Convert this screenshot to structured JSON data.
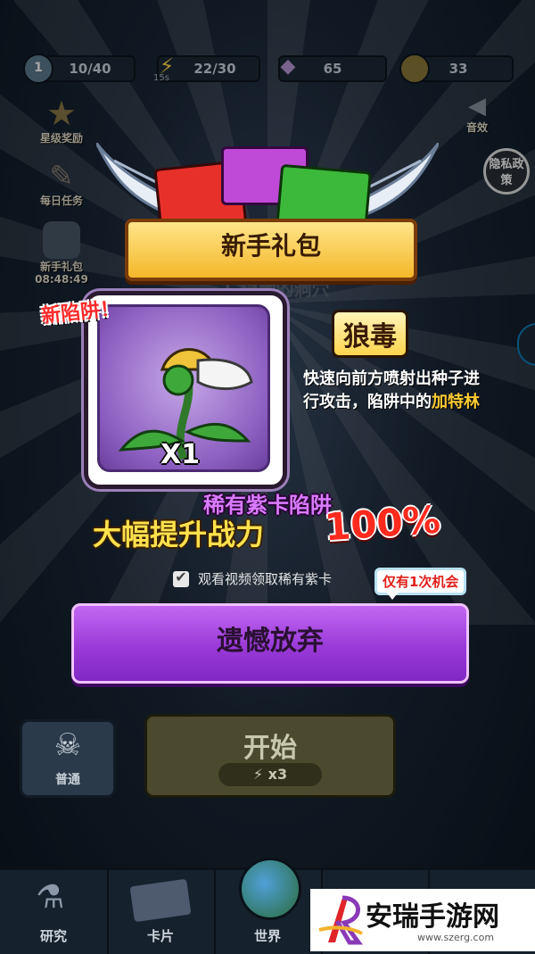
{
  "stats": {
    "level": "1",
    "progress": "10/40",
    "energy": "22/30",
    "energy_timer": "15s",
    "gems": "65",
    "coins": "33"
  },
  "side_menu": {
    "star_reward": "星级奖励",
    "daily_task": "每日任务",
    "newbie_pack": "新手礼包",
    "newbie_timer": "08:48:49",
    "sound": "音效",
    "privacy": "隐私政策"
  },
  "background_text": {
    "stage_title": "1.隐藏的洞穴"
  },
  "popup": {
    "title": "新手礼包",
    "card_tag": "新陷阱！",
    "card_count": "X1",
    "trap_name": "狼毒",
    "description_main": "快速向前方喷射出种子进行攻击，陷阱中的",
    "description_highlight": "加特林",
    "rarity": "稀有紫卡陷阱",
    "boost_label": "大幅提升战力",
    "boost_value": "100%",
    "video_option": "观看视频领取稀有紫卡",
    "chance_tag": "仅有1次机会",
    "abandon_button": "遗憾放弃"
  },
  "game_buttons": {
    "normal": "普通",
    "start": "开始",
    "start_cost": "x3"
  },
  "bottom_nav": [
    "研究",
    "卡片",
    "世界"
  ],
  "watermark": {
    "name": "安瑞手游网",
    "url": "www.szerg.com"
  },
  "colors": {
    "banner": "#f4b72a",
    "abandon_button": "#9a3ad8",
    "rarity": "#d97bff",
    "highlight": "#ffcc33",
    "boost_pct": "#ff2a1e"
  }
}
